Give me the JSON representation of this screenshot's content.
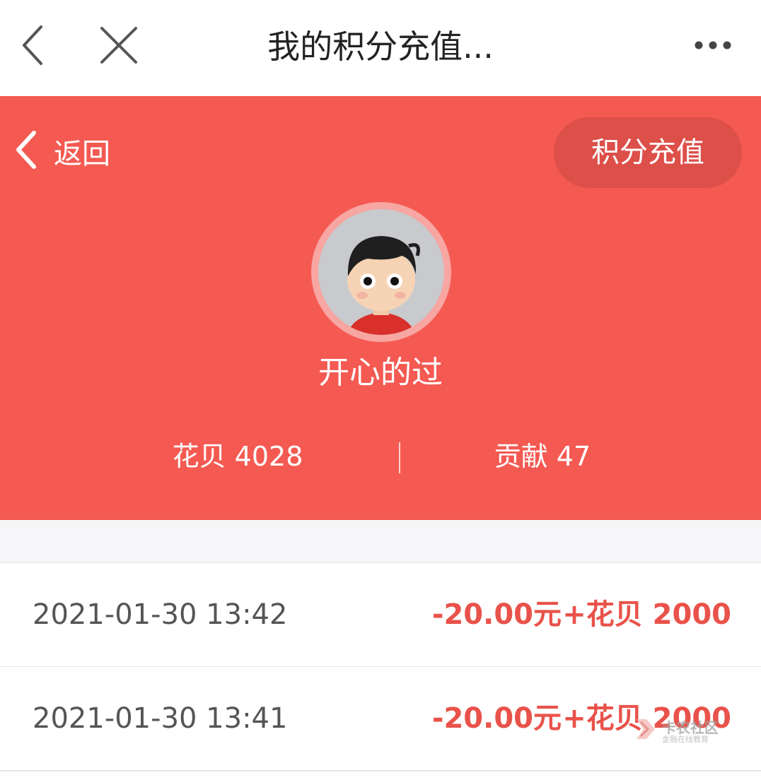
{
  "topbar": {
    "title": "我的积分充值...",
    "back_icon": "chevron-left-icon",
    "close_icon": "close-icon",
    "more_icon": "more-dots-icon"
  },
  "hero": {
    "background_color": "#f45a52",
    "back_label": "返回",
    "recharge_button": "积分充值",
    "username": "开心的过",
    "stats": {
      "huabei": "花贝 4028",
      "contribution": "贡献 47"
    }
  },
  "records": [
    {
      "time": "2021-01-30 13:42",
      "amount": "-20.00元",
      "points": "+花贝 2000"
    },
    {
      "time": "2021-01-30 13:41",
      "amount": "-20.00元",
      "points": "+花贝 2000"
    }
  ],
  "watermark": {
    "line1": "卡农社区",
    "line2": "金融在线教育"
  }
}
